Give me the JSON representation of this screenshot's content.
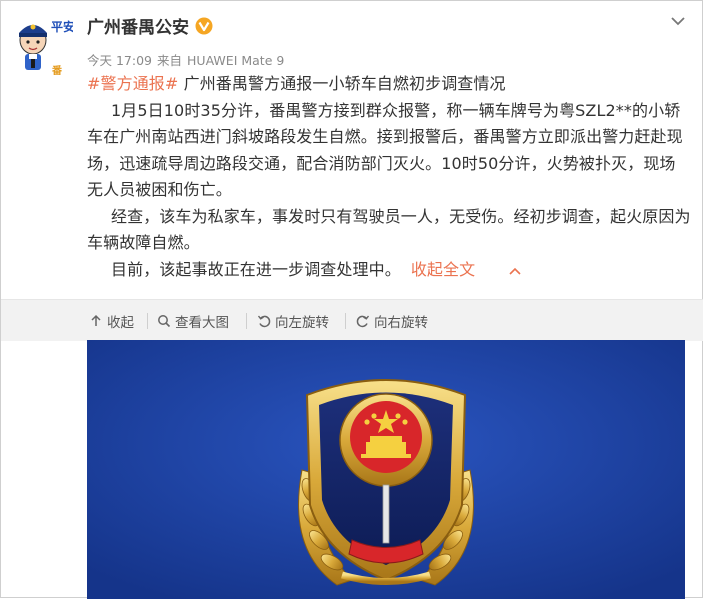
{
  "account": {
    "avatar_text_top": "平安",
    "avatar_text_bottom": "番禺",
    "name": "广州番禺公安",
    "verified_icon": "verified-v-badge-icon",
    "time": "今天 17:09",
    "source_prefix": "来自",
    "device": "HUAWEI Mate 9"
  },
  "post": {
    "hashtag": "#警方通报#",
    "headline": " 广州番禺警方通报一小轿车自燃初步调查情况",
    "paragraphs": [
      "1月5日10时35分许，番禺警方接到群众报警，称一辆车牌号为粤SZL2**的小轿车在广州南站西进门斜坡路段发生自燃。接到报警后，番禺警方立即派出警力赶赴现场，迅速疏导周边路段交通，配合消防部门灭火。10时50分许，火势被扑灭，现场无人员被困和伤亡。",
      "经查，该车为私家车，事发时只有驾驶员一人，无受伤。经初步调查，起火原因为车辆故障自燃。"
    ],
    "last_paragraph": "目前，该起事故正在进一步调查处理中。",
    "collapse_label": "收起全文"
  },
  "toolbar": {
    "collapse_label": "收起",
    "view_large_label": "查看大图",
    "rotate_left_label": "向左旋转",
    "rotate_right_label": "向右旋转"
  },
  "colors": {
    "accent_orange": "#eb7350",
    "verified_gold": "#f5a623",
    "photo_blue": "#1c3f9e",
    "toolbar_bg": "#f2f2f2"
  }
}
